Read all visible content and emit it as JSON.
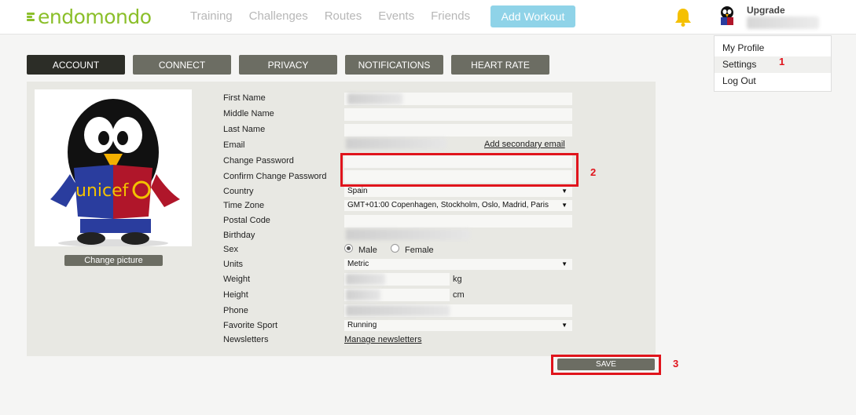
{
  "header": {
    "logo_text": "endomondo",
    "nav": [
      "Training",
      "Challenges",
      "Routes",
      "Events",
      "Friends"
    ],
    "add_workout": "Add Workout",
    "upgrade": "Upgrade"
  },
  "menu": {
    "items": [
      "My Profile",
      "Settings",
      "Log Out"
    ],
    "active": "Settings"
  },
  "markers": [
    "1",
    "2",
    "3"
  ],
  "tabs": [
    {
      "label": "ACCOUNT",
      "active": true
    },
    {
      "label": "CONNECT",
      "active": false
    },
    {
      "label": "PRIVACY",
      "active": false
    },
    {
      "label": "NOTIFICATIONS",
      "active": false
    },
    {
      "label": "HEART RATE",
      "active": false
    }
  ],
  "profile": {
    "change_picture": "Change picture",
    "labels": {
      "first_name": "First Name",
      "middle_name": "Middle Name",
      "last_name": "Last Name",
      "email": "Email",
      "change_password": "Change Password",
      "confirm_password": "Confirm Change Password",
      "country": "Country",
      "time_zone": "Time Zone",
      "postal_code": "Postal Code",
      "birthday": "Birthday",
      "sex": "Sex",
      "units": "Units",
      "weight": "Weight",
      "height": "Height",
      "phone": "Phone",
      "favorite_sport": "Favorite Sport",
      "newsletters": "Newsletters"
    },
    "values": {
      "country": "Spain",
      "time_zone": "GMT+01:00 Copenhagen, Stockholm, Oslo, Madrid, Paris",
      "units": "Metric",
      "favorite_sport": "Running",
      "sex_selected": "Male"
    },
    "sex_options": [
      "Male",
      "Female"
    ],
    "weight_unit": "kg",
    "height_unit": "cm",
    "add_secondary_email": "Add secondary email",
    "manage_newsletters": "Manage newsletters",
    "save": "SAVE"
  },
  "colors": {
    "brand_green": "#8bbf2a",
    "tab_bg": "#6c6d63",
    "tab_active": "#2c2d27",
    "highlight_red": "#e0141c",
    "add_workout_bg": "#8fd3e8"
  }
}
